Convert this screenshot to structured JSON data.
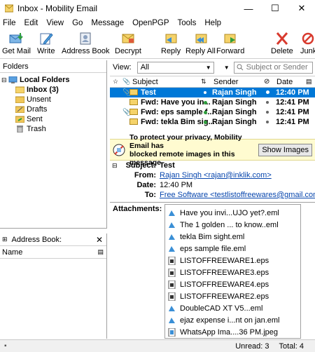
{
  "window": {
    "title": "Inbox - Mobility Email"
  },
  "menu": [
    "File",
    "Edit",
    "View",
    "Go",
    "Message",
    "OpenPGP",
    "Tools",
    "Help"
  ],
  "toolbar": {
    "get_mail": "Get Mail",
    "write": "Write",
    "address_book": "Address Book",
    "decrypt": "Decrypt",
    "reply": "Reply",
    "reply_all": "Reply All",
    "forward": "Forward",
    "delete": "Delete",
    "junk": "Junk"
  },
  "folders": {
    "header": "Folders",
    "root": "Local Folders",
    "items": [
      "Inbox (3)",
      "Unsent",
      "Drafts",
      "Sent",
      "Trash"
    ]
  },
  "address_book_pane": {
    "title": "Address Book:",
    "column": "Name"
  },
  "view_bar": {
    "label": "View:",
    "selected": "All",
    "search_placeholder": "Subject or Sender"
  },
  "message_list": {
    "columns": {
      "subject": "Subject",
      "sender": "Sender",
      "date": "Date"
    },
    "rows": [
      {
        "subject": "Test",
        "sender": "Rajan Singh",
        "date": "12:40 PM"
      },
      {
        "subject": "Fwd: Have you in...",
        "sender": "Rajan Singh",
        "date": "12:41 PM"
      },
      {
        "subject": "Fwd: eps sample f...",
        "sender": "Rajan Singh",
        "date": "12:41 PM"
      },
      {
        "subject": "Fwd: tekla Bim sig...",
        "sender": "Rajan Singh",
        "date": "12:41 PM"
      }
    ]
  },
  "privacy_notice": {
    "line1": "To protect your privacy, Mobility Email has",
    "line2": "blocked remote images in this message.",
    "button": "Show Images"
  },
  "message_header": {
    "subject_label": "Subject:",
    "subject": "Test",
    "from_label": "From:",
    "from": "Rajan Singh <rajan@inklik.com>",
    "date_label": "Date:",
    "date": "12:40 PM",
    "to_label": "To:",
    "to": "Free Software <testlistoffreewares@gmail.com>"
  },
  "attachments": {
    "label": "Attachments:",
    "items": [
      "Have you invi...UJO yet?.eml",
      "The 1 golden ... to know..eml",
      "tekla Bim sight.eml",
      "eps sample file.eml",
      "LISTOFFREEWARE1.eps",
      "LISTOFFREEWARE3.eps",
      "LISTOFFREEWARE4.eps",
      "LISTOFFREEWARE2.eps",
      "DoubleCAD XT V5...eml",
      "ejaz expense i...nt on jan.eml",
      "WhatsApp Ima....36 PM.jpeg"
    ]
  },
  "status": {
    "unread": "Unread: 3",
    "total": "Total: 4"
  },
  "colors": {
    "accent": "#0078d7",
    "notice_bg": "#fffbd0",
    "link": "#0645ad"
  }
}
